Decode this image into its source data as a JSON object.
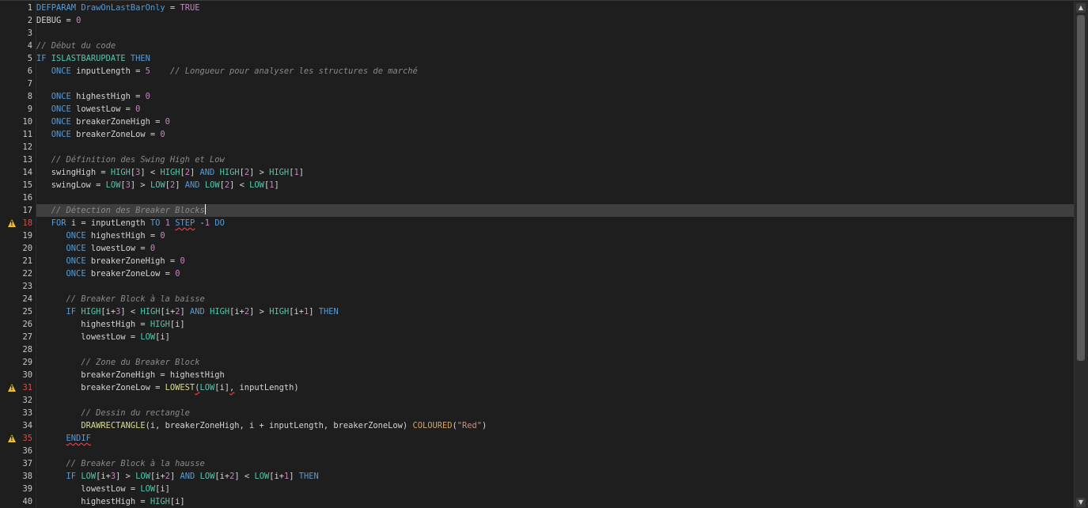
{
  "editor": {
    "current_line": 17,
    "lines": [
      {
        "n": "1",
        "marker": "",
        "tokens": [
          [
            "kw",
            "DEFPARAM"
          ],
          [
            "op",
            " "
          ],
          [
            "kw",
            "DrawOnLastBarOnly"
          ],
          [
            "op",
            " = "
          ],
          [
            "num",
            "TRUE"
          ]
        ]
      },
      {
        "n": "2",
        "marker": "",
        "tokens": [
          [
            "var",
            "DEBUG"
          ],
          [
            "op",
            " = "
          ],
          [
            "num",
            "0"
          ]
        ]
      },
      {
        "n": "3",
        "marker": "",
        "tokens": []
      },
      {
        "n": "4",
        "marker": "",
        "tokens": [
          [
            "cmt",
            "// Début du code"
          ]
        ]
      },
      {
        "n": "5",
        "marker": "",
        "tokens": [
          [
            "kw",
            "IF"
          ],
          [
            "op",
            " "
          ],
          [
            "fn",
            "ISLASTBARUPDATE"
          ],
          [
            "op",
            " "
          ],
          [
            "kw",
            "THEN"
          ]
        ]
      },
      {
        "n": "6",
        "marker": "",
        "tokens": [
          [
            "op",
            "   "
          ],
          [
            "kw",
            "ONCE"
          ],
          [
            "op",
            " inputLength = "
          ],
          [
            "num",
            "5"
          ],
          [
            "op",
            "    "
          ],
          [
            "cmt",
            "// Longueur pour analyser les structures de marché"
          ]
        ]
      },
      {
        "n": "7",
        "marker": "",
        "tokens": []
      },
      {
        "n": "8",
        "marker": "",
        "tokens": [
          [
            "op",
            "   "
          ],
          [
            "kw",
            "ONCE"
          ],
          [
            "op",
            " highestHigh = "
          ],
          [
            "num",
            "0"
          ]
        ]
      },
      {
        "n": "9",
        "marker": "",
        "tokens": [
          [
            "op",
            "   "
          ],
          [
            "kw",
            "ONCE"
          ],
          [
            "op",
            " lowestLow = "
          ],
          [
            "num",
            "0"
          ]
        ]
      },
      {
        "n": "10",
        "marker": "",
        "tokens": [
          [
            "op",
            "   "
          ],
          [
            "kw",
            "ONCE"
          ],
          [
            "op",
            " breakerZoneHigh = "
          ],
          [
            "num",
            "0"
          ]
        ]
      },
      {
        "n": "11",
        "marker": "",
        "tokens": [
          [
            "op",
            "   "
          ],
          [
            "kw",
            "ONCE"
          ],
          [
            "op",
            " breakerZoneLow = "
          ],
          [
            "num",
            "0"
          ]
        ]
      },
      {
        "n": "12",
        "marker": "",
        "tokens": []
      },
      {
        "n": "13",
        "marker": "",
        "tokens": [
          [
            "op",
            "   "
          ],
          [
            "cmt",
            "// Définition des Swing High et Low"
          ]
        ]
      },
      {
        "n": "14",
        "marker": "",
        "tokens": [
          [
            "op",
            "   swingHigh = "
          ],
          [
            "fn",
            "HIGH"
          ],
          [
            "op",
            "["
          ],
          [
            "num",
            "3"
          ],
          [
            "op",
            "] < "
          ],
          [
            "fn",
            "HIGH"
          ],
          [
            "op",
            "["
          ],
          [
            "num",
            "2"
          ],
          [
            "op",
            "] "
          ],
          [
            "kw",
            "AND"
          ],
          [
            "op",
            " "
          ],
          [
            "fn",
            "HIGH"
          ],
          [
            "op",
            "["
          ],
          [
            "num",
            "2"
          ],
          [
            "op",
            "] > "
          ],
          [
            "fn",
            "HIGH"
          ],
          [
            "op",
            "["
          ],
          [
            "num",
            "1"
          ],
          [
            "op",
            "]"
          ]
        ]
      },
      {
        "n": "15",
        "marker": "",
        "tokens": [
          [
            "op",
            "   swingLow = "
          ],
          [
            "fn",
            "LOW"
          ],
          [
            "op",
            "["
          ],
          [
            "num",
            "3"
          ],
          [
            "op",
            "] > "
          ],
          [
            "fn",
            "LOW"
          ],
          [
            "op",
            "["
          ],
          [
            "num",
            "2"
          ],
          [
            "op",
            "] "
          ],
          [
            "kw",
            "AND"
          ],
          [
            "op",
            " "
          ],
          [
            "fn",
            "LOW"
          ],
          [
            "op",
            "["
          ],
          [
            "num",
            "2"
          ],
          [
            "op",
            "] < "
          ],
          [
            "fn",
            "LOW"
          ],
          [
            "op",
            "["
          ],
          [
            "num",
            "1"
          ],
          [
            "op",
            "]"
          ]
        ]
      },
      {
        "n": "16",
        "marker": "",
        "tokens": []
      },
      {
        "n": "17",
        "marker": "",
        "tokens": [
          [
            "op",
            "   "
          ],
          [
            "cmt",
            "// Détection des Breaker Blocks"
          ],
          [
            "caret",
            ""
          ]
        ]
      },
      {
        "n": "18",
        "marker": "warning",
        "tokens": [
          [
            "op",
            "   "
          ],
          [
            "kw",
            "FOR"
          ],
          [
            "op",
            " i = inputLength "
          ],
          [
            "kw",
            "TO"
          ],
          [
            "op",
            " "
          ],
          [
            "num",
            "1"
          ],
          [
            "op",
            " "
          ],
          [
            "kwerr",
            "STEP"
          ],
          [
            "op",
            " -"
          ],
          [
            "num",
            "1"
          ],
          [
            "op",
            " "
          ],
          [
            "kw",
            "DO"
          ]
        ]
      },
      {
        "n": "19",
        "marker": "",
        "tokens": [
          [
            "op",
            "      "
          ],
          [
            "kw",
            "ONCE"
          ],
          [
            "op",
            " highestHigh = "
          ],
          [
            "num",
            "0"
          ]
        ]
      },
      {
        "n": "20",
        "marker": "",
        "tokens": [
          [
            "op",
            "      "
          ],
          [
            "kw",
            "ONCE"
          ],
          [
            "op",
            " lowestLow = "
          ],
          [
            "num",
            "0"
          ]
        ]
      },
      {
        "n": "21",
        "marker": "",
        "tokens": [
          [
            "op",
            "      "
          ],
          [
            "kw",
            "ONCE"
          ],
          [
            "op",
            " breakerZoneHigh = "
          ],
          [
            "num",
            "0"
          ]
        ]
      },
      {
        "n": "22",
        "marker": "",
        "tokens": [
          [
            "op",
            "      "
          ],
          [
            "kw",
            "ONCE"
          ],
          [
            "op",
            " breakerZoneLow = "
          ],
          [
            "num",
            "0"
          ]
        ]
      },
      {
        "n": "23",
        "marker": "",
        "tokens": []
      },
      {
        "n": "24",
        "marker": "",
        "tokens": [
          [
            "op",
            "      "
          ],
          [
            "cmt",
            "// Breaker Block à la baisse"
          ]
        ]
      },
      {
        "n": "25",
        "marker": "",
        "tokens": [
          [
            "op",
            "      "
          ],
          [
            "kw",
            "IF"
          ],
          [
            "op",
            " "
          ],
          [
            "fn",
            "HIGH"
          ],
          [
            "op",
            "[i+"
          ],
          [
            "num",
            "3"
          ],
          [
            "op",
            "] < "
          ],
          [
            "fn",
            "HIGH"
          ],
          [
            "op",
            "[i+"
          ],
          [
            "num",
            "2"
          ],
          [
            "op",
            "] "
          ],
          [
            "kw",
            "AND"
          ],
          [
            "op",
            " "
          ],
          [
            "fn",
            "HIGH"
          ],
          [
            "op",
            "[i+"
          ],
          [
            "num",
            "2"
          ],
          [
            "op",
            "] > "
          ],
          [
            "fn",
            "HIGH"
          ],
          [
            "op",
            "[i+"
          ],
          [
            "num",
            "1"
          ],
          [
            "op",
            "] "
          ],
          [
            "kw",
            "THEN"
          ]
        ]
      },
      {
        "n": "26",
        "marker": "",
        "tokens": [
          [
            "op",
            "         highestHigh = "
          ],
          [
            "fn",
            "HIGH"
          ],
          [
            "op",
            "[i]"
          ]
        ]
      },
      {
        "n": "27",
        "marker": "",
        "tokens": [
          [
            "op",
            "         lowestLow = "
          ],
          [
            "fn",
            "LOW"
          ],
          [
            "op",
            "[i]"
          ]
        ]
      },
      {
        "n": "28",
        "marker": "",
        "tokens": []
      },
      {
        "n": "29",
        "marker": "",
        "tokens": [
          [
            "op",
            "         "
          ],
          [
            "cmt",
            "// Zone du Breaker Block"
          ]
        ]
      },
      {
        "n": "30",
        "marker": "",
        "tokens": [
          [
            "op",
            "         breakerZoneHigh = highestHigh"
          ]
        ]
      },
      {
        "n": "31",
        "marker": "warning",
        "tokens": [
          [
            "op",
            "         breakerZoneLow = "
          ],
          [
            "draw",
            "LOWEST"
          ],
          [
            "operr",
            "("
          ],
          [
            "fn",
            "LOW"
          ],
          [
            "op",
            "[i]"
          ],
          [
            "operr",
            ","
          ],
          [
            "op",
            " inputLength)"
          ]
        ]
      },
      {
        "n": "32",
        "marker": "",
        "tokens": []
      },
      {
        "n": "33",
        "marker": "",
        "tokens": [
          [
            "op",
            "         "
          ],
          [
            "cmt",
            "// Dessin du rectangle"
          ]
        ]
      },
      {
        "n": "34",
        "marker": "",
        "tokens": [
          [
            "op",
            "         "
          ],
          [
            "draw",
            "DRAWRECTANGLE"
          ],
          [
            "op",
            "(i, breakerZoneHigh, i + inputLength, breakerZoneLow) "
          ],
          [
            "col",
            "COLOURED"
          ],
          [
            "op",
            "("
          ],
          [
            "str",
            "\"Red\""
          ],
          [
            "op",
            ")"
          ]
        ]
      },
      {
        "n": "35",
        "marker": "warning",
        "tokens": [
          [
            "op",
            "      "
          ],
          [
            "kwerr",
            "ENDIF"
          ]
        ]
      },
      {
        "n": "36",
        "marker": "",
        "tokens": []
      },
      {
        "n": "37",
        "marker": "",
        "tokens": [
          [
            "op",
            "      "
          ],
          [
            "cmt",
            "// Breaker Block à la hausse"
          ]
        ]
      },
      {
        "n": "38",
        "marker": "",
        "tokens": [
          [
            "op",
            "      "
          ],
          [
            "kw",
            "IF"
          ],
          [
            "op",
            " "
          ],
          [
            "fn",
            "LOW"
          ],
          [
            "op",
            "[i+"
          ],
          [
            "num",
            "3"
          ],
          [
            "op",
            "] > "
          ],
          [
            "fn",
            "LOW"
          ],
          [
            "op",
            "[i+"
          ],
          [
            "num",
            "2"
          ],
          [
            "op",
            "] "
          ],
          [
            "kw",
            "AND"
          ],
          [
            "op",
            " "
          ],
          [
            "fn",
            "LOW"
          ],
          [
            "op",
            "[i+"
          ],
          [
            "num",
            "2"
          ],
          [
            "op",
            "] < "
          ],
          [
            "fn",
            "LOW"
          ],
          [
            "op",
            "[i+"
          ],
          [
            "num",
            "1"
          ],
          [
            "op",
            "] "
          ],
          [
            "kw",
            "THEN"
          ]
        ]
      },
      {
        "n": "39",
        "marker": "",
        "tokens": [
          [
            "op",
            "         lowestLow = "
          ],
          [
            "fn",
            "LOW"
          ],
          [
            "op",
            "[i]"
          ]
        ]
      },
      {
        "n": "40",
        "marker": "",
        "tokens": [
          [
            "op",
            "         highestHigh = "
          ],
          [
            "fn",
            "HIGH"
          ],
          [
            "op",
            "[i]"
          ]
        ]
      }
    ]
  },
  "scrollbar": {
    "up_icon": "▲",
    "down_icon": "▼",
    "thumb_fraction": 0.72
  },
  "colors": {
    "background": "#1e1e1e",
    "keyword": "#569cd6",
    "function": "#4ec9b0",
    "number": "#c586c0",
    "comment": "#8a8a8a",
    "error": "#e04848",
    "warning": "#f0c020"
  }
}
